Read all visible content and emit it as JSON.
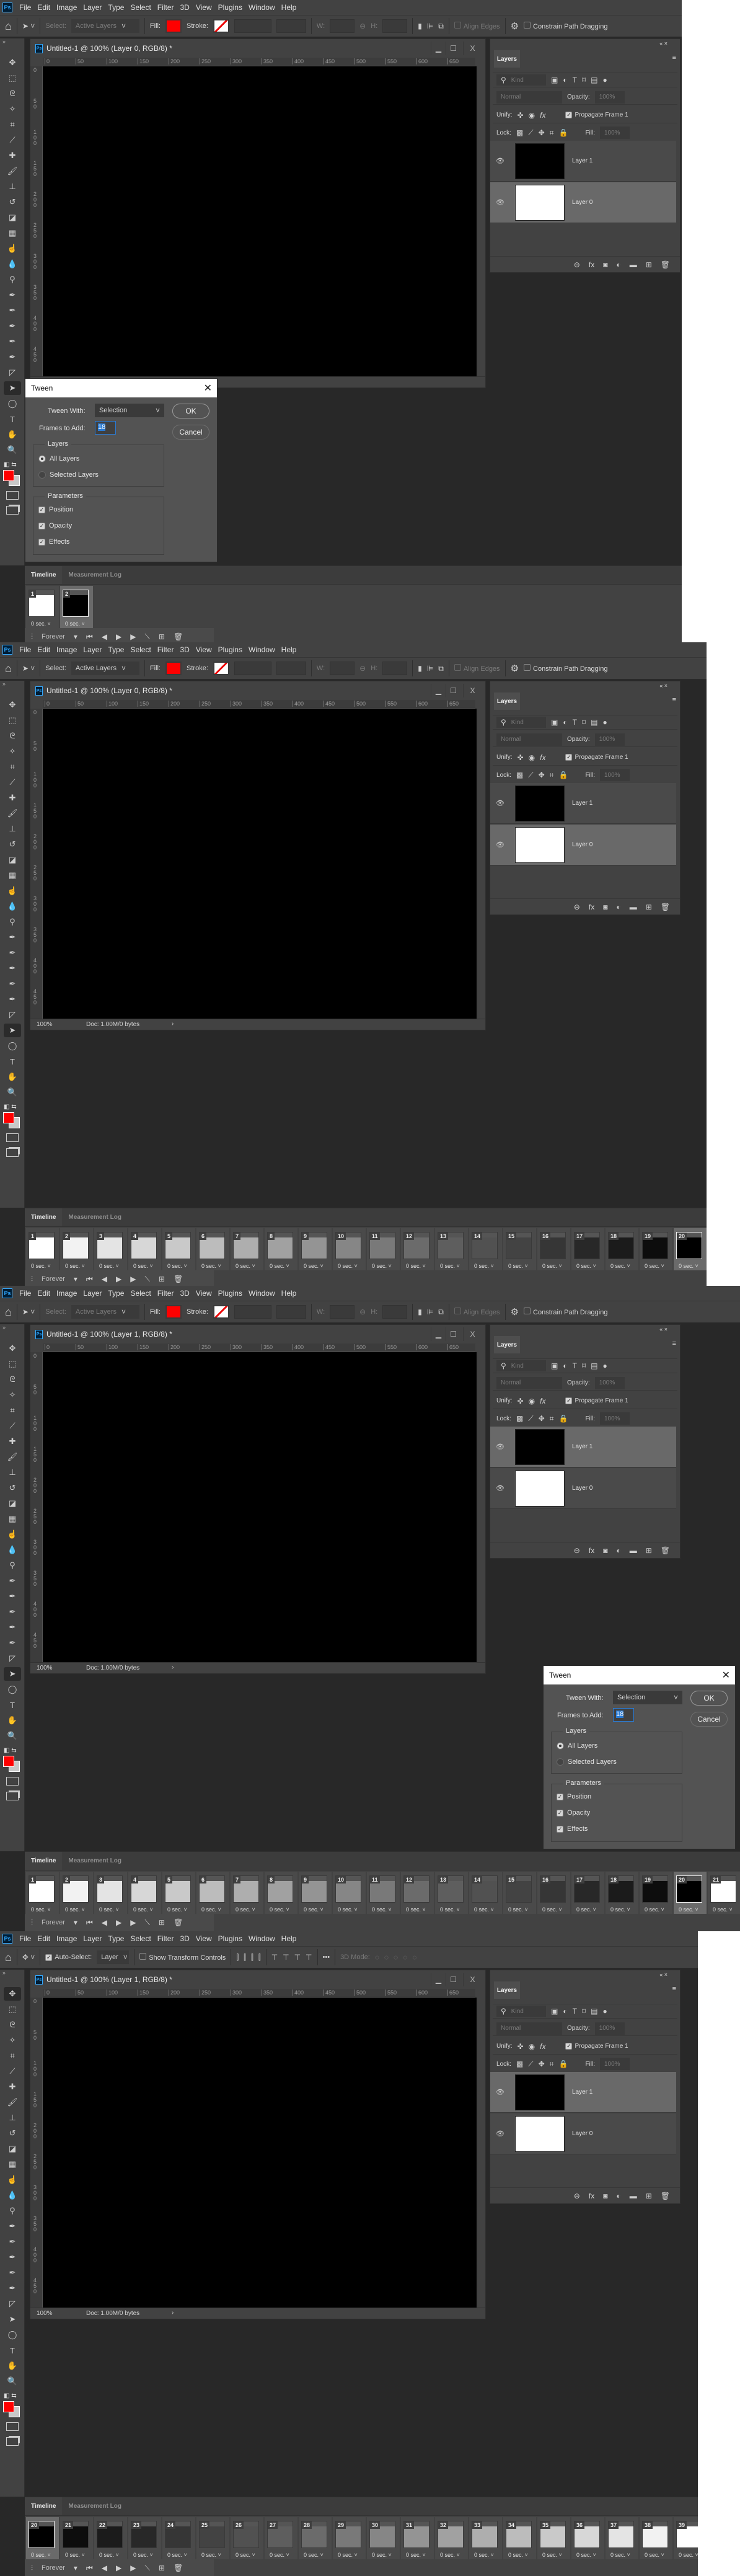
{
  "app": {
    "logo": "Ps",
    "menu": [
      "File",
      "Edit",
      "Image",
      "Layer",
      "Type",
      "Select",
      "Filter",
      "3D",
      "View",
      "Plugins",
      "Window",
      "Help"
    ]
  },
  "options_path": {
    "select_label": "Select:",
    "select_value": "Active Layers",
    "fill_label": "Fill:",
    "fill_color": "#ff0000",
    "stroke_label": "Stroke:",
    "w_label": "W:",
    "h_label": "H:",
    "align_edges": "Align Edges",
    "constrain": "Constrain Path Dragging"
  },
  "options_move": {
    "auto_select": "Auto-Select:",
    "auto_select_value": "Layer",
    "show_transform": "Show Transform Controls",
    "more": "•••",
    "mode3d": "3D Mode:"
  },
  "document": {
    "rulers_h": [
      "0",
      "50",
      "100",
      "150",
      "200",
      "250",
      "300",
      "350",
      "400",
      "450",
      "500",
      "550",
      "600",
      "650"
    ],
    "rulers_v": [
      "0",
      "50",
      "100",
      "150",
      "200",
      "250",
      "300",
      "350",
      "400",
      "450"
    ],
    "zoom": "100%",
    "doc_info": "Doc: 1.00M/0 bytes"
  },
  "layers_panel": {
    "tab": "Layers",
    "kind": "Kind",
    "blend_mode": "Normal",
    "opacity_label": "Opacity:",
    "opacity": "100%",
    "unify_label": "Unify:",
    "propagate": "Propagate Frame 1",
    "lock_label": "Lock:",
    "fill_label": "Fill:",
    "fill": "100%",
    "layers": [
      {
        "name": "Layer 1",
        "thumb": "#000000"
      },
      {
        "name": "Layer 0",
        "thumb": "#ffffff"
      }
    ]
  },
  "timeline": {
    "tab_timeline": "Timeline",
    "tab_measurement": "Measurement Log",
    "delay": "0 sec.",
    "loop": "Forever"
  },
  "tween_dialog": {
    "title": "Tween",
    "tween_with_label": "Tween With:",
    "tween_with": "Selection",
    "frames_label": "Frames to Add:",
    "frames_value": "18",
    "ok": "OK",
    "cancel": "Cancel",
    "layers_group": "Layers",
    "all_layers": "All Layers",
    "selected_layers": "Selected Layers",
    "params_group": "Parameters",
    "position": "Position",
    "opacity": "Opacity",
    "effects": "Effects",
    "layers_choice": "All Layers",
    "position_checked": true,
    "opacity_checked": true,
    "effects_checked": true
  },
  "screens": [
    {
      "doc_title": "Untitled-1 @ 100% (Layer 0, RGB/8) *",
      "tool_mode": "path",
      "select_enabled": false,
      "selected_layer": "Layer 0",
      "dialog_open": true,
      "frames": [
        {
          "n": "1",
          "thumb": "#ffffff"
        },
        {
          "n": "2",
          "thumb": "#000000",
          "selected": true
        }
      ]
    },
    {
      "doc_title": "Untitled-1 @ 100% (Layer 0, RGB/8) *",
      "tool_mode": "path",
      "select_enabled": true,
      "selected_layer": "Layer 0",
      "dialog_open": false,
      "frames": [
        {
          "n": "1",
          "thumb": "#ffffff"
        },
        {
          "n": "2",
          "thumb": "#f2f2f2"
        },
        {
          "n": "3",
          "thumb": "#e4e4e4"
        },
        {
          "n": "4",
          "thumb": "#d7d7d7"
        },
        {
          "n": "5",
          "thumb": "#c9c9c9"
        },
        {
          "n": "6",
          "thumb": "#bcbcbc"
        },
        {
          "n": "7",
          "thumb": "#aeaeae"
        },
        {
          "n": "8",
          "thumb": "#a1a1a1"
        },
        {
          "n": "9",
          "thumb": "#949494"
        },
        {
          "n": "10",
          "thumb": "#868686"
        },
        {
          "n": "11",
          "thumb": "#797979"
        },
        {
          "n": "12",
          "thumb": "#6b6b6b"
        },
        {
          "n": "13",
          "thumb": "#5e5e5e"
        },
        {
          "n": "14",
          "thumb": "#515151"
        },
        {
          "n": "15",
          "thumb": "#434343"
        },
        {
          "n": "16",
          "thumb": "#363636"
        },
        {
          "n": "17",
          "thumb": "#282828"
        },
        {
          "n": "18",
          "thumb": "#1b1b1b"
        },
        {
          "n": "19",
          "thumb": "#0d0d0d"
        },
        {
          "n": "20",
          "thumb": "#000000",
          "selected": true
        }
      ]
    },
    {
      "doc_title": "Untitled-1 @ 100% (Layer 1, RGB/8) *",
      "tool_mode": "path",
      "select_enabled": false,
      "selected_layer": "Layer 1",
      "dialog_open": true,
      "frames": [
        {
          "n": "1",
          "thumb": "#ffffff"
        },
        {
          "n": "2",
          "thumb": "#f2f2f2"
        },
        {
          "n": "3",
          "thumb": "#e4e4e4"
        },
        {
          "n": "4",
          "thumb": "#d7d7d7"
        },
        {
          "n": "5",
          "thumb": "#c9c9c9"
        },
        {
          "n": "6",
          "thumb": "#bcbcbc"
        },
        {
          "n": "7",
          "thumb": "#aeaeae"
        },
        {
          "n": "8",
          "thumb": "#a1a1a1"
        },
        {
          "n": "9",
          "thumb": "#949494"
        },
        {
          "n": "10",
          "thumb": "#868686"
        },
        {
          "n": "11",
          "thumb": "#797979"
        },
        {
          "n": "12",
          "thumb": "#6b6b6b"
        },
        {
          "n": "13",
          "thumb": "#5e5e5e"
        },
        {
          "n": "14",
          "thumb": "#515151"
        },
        {
          "n": "15",
          "thumb": "#434343"
        },
        {
          "n": "16",
          "thumb": "#363636"
        },
        {
          "n": "17",
          "thumb": "#282828"
        },
        {
          "n": "18",
          "thumb": "#1b1b1b"
        },
        {
          "n": "19",
          "thumb": "#0d0d0d"
        },
        {
          "n": "20",
          "thumb": "#000000",
          "selected": true
        },
        {
          "n": "21",
          "thumb": "#ffffff"
        }
      ]
    },
    {
      "doc_title": "Untitled-1 @ 100% (Layer 1, RGB/8) *",
      "tool_mode": "move",
      "select_enabled": true,
      "selected_layer": "Layer 1",
      "dialog_open": false,
      "frames": [
        {
          "n": "20",
          "thumb": "#000000",
          "selected": true
        },
        {
          "n": "21",
          "thumb": "#0d0d0d"
        },
        {
          "n": "22",
          "thumb": "#1b1b1b"
        },
        {
          "n": "23",
          "thumb": "#282828"
        },
        {
          "n": "24",
          "thumb": "#363636"
        },
        {
          "n": "25",
          "thumb": "#434343"
        },
        {
          "n": "26",
          "thumb": "#515151"
        },
        {
          "n": "27",
          "thumb": "#5e5e5e"
        },
        {
          "n": "28",
          "thumb": "#6b6b6b"
        },
        {
          "n": "29",
          "thumb": "#797979"
        },
        {
          "n": "30",
          "thumb": "#868686"
        },
        {
          "n": "31",
          "thumb": "#949494"
        },
        {
          "n": "32",
          "thumb": "#a1a1a1"
        },
        {
          "n": "33",
          "thumb": "#aeaeae"
        },
        {
          "n": "34",
          "thumb": "#bcbcbc"
        },
        {
          "n": "35",
          "thumb": "#c9c9c9"
        },
        {
          "n": "36",
          "thumb": "#d7d7d7"
        },
        {
          "n": "37",
          "thumb": "#e4e4e4"
        },
        {
          "n": "38",
          "thumb": "#f2f2f2"
        },
        {
          "n": "39",
          "thumb": "#ffffff"
        }
      ]
    }
  ],
  "tools": [
    {
      "name": "move-tool-icon",
      "glyph": "✥"
    },
    {
      "name": "marquee-tool-icon",
      "glyph": "⬚"
    },
    {
      "name": "lasso-tool-icon",
      "glyph": "ᘓ"
    },
    {
      "name": "magic-wand-tool-icon",
      "glyph": "✧"
    },
    {
      "name": "crop-tool-icon",
      "glyph": "⌗"
    },
    {
      "name": "eyedropper-tool-icon",
      "glyph": "⟋"
    },
    {
      "name": "healing-brush-tool-icon",
      "glyph": "✚"
    },
    {
      "name": "brush-tool-icon",
      "glyph": "🖌"
    },
    {
      "name": "clone-stamp-tool-icon",
      "glyph": "⊥"
    },
    {
      "name": "history-brush-tool-icon",
      "glyph": "↺"
    },
    {
      "name": "eraser-tool-icon",
      "glyph": "◪"
    },
    {
      "name": "gradient-tool-icon",
      "glyph": "▦"
    },
    {
      "name": "smudge-tool-icon",
      "glyph": "☝"
    },
    {
      "name": "blur-tool-icon",
      "glyph": "💧"
    },
    {
      "name": "dodge-tool-icon",
      "glyph": "⚲"
    },
    {
      "name": "pen-tool-icon",
      "glyph": "✒"
    },
    {
      "name": "freeform-pen-tool-icon",
      "glyph": "✒"
    },
    {
      "name": "add-anchor-tool-icon",
      "glyph": "✒"
    },
    {
      "name": "delete-anchor-tool-icon",
      "glyph": "✒"
    },
    {
      "name": "convert-point-tool-icon",
      "glyph": "✒"
    },
    {
      "name": "path-selection-tool-icon",
      "glyph": "◸"
    },
    {
      "name": "direct-selection-tool-icon",
      "glyph": "➤"
    },
    {
      "name": "ellipse-tool-icon",
      "glyph": "◯"
    },
    {
      "name": "type-tool-icon",
      "glyph": "T"
    },
    {
      "name": "hand-tool-icon",
      "glyph": "✋"
    },
    {
      "name": "zoom-tool-icon",
      "glyph": "🔍"
    }
  ],
  "colors": {
    "foreground": "#ff0000",
    "background": "#c8c8c8",
    "accent": "#31a8ff"
  }
}
